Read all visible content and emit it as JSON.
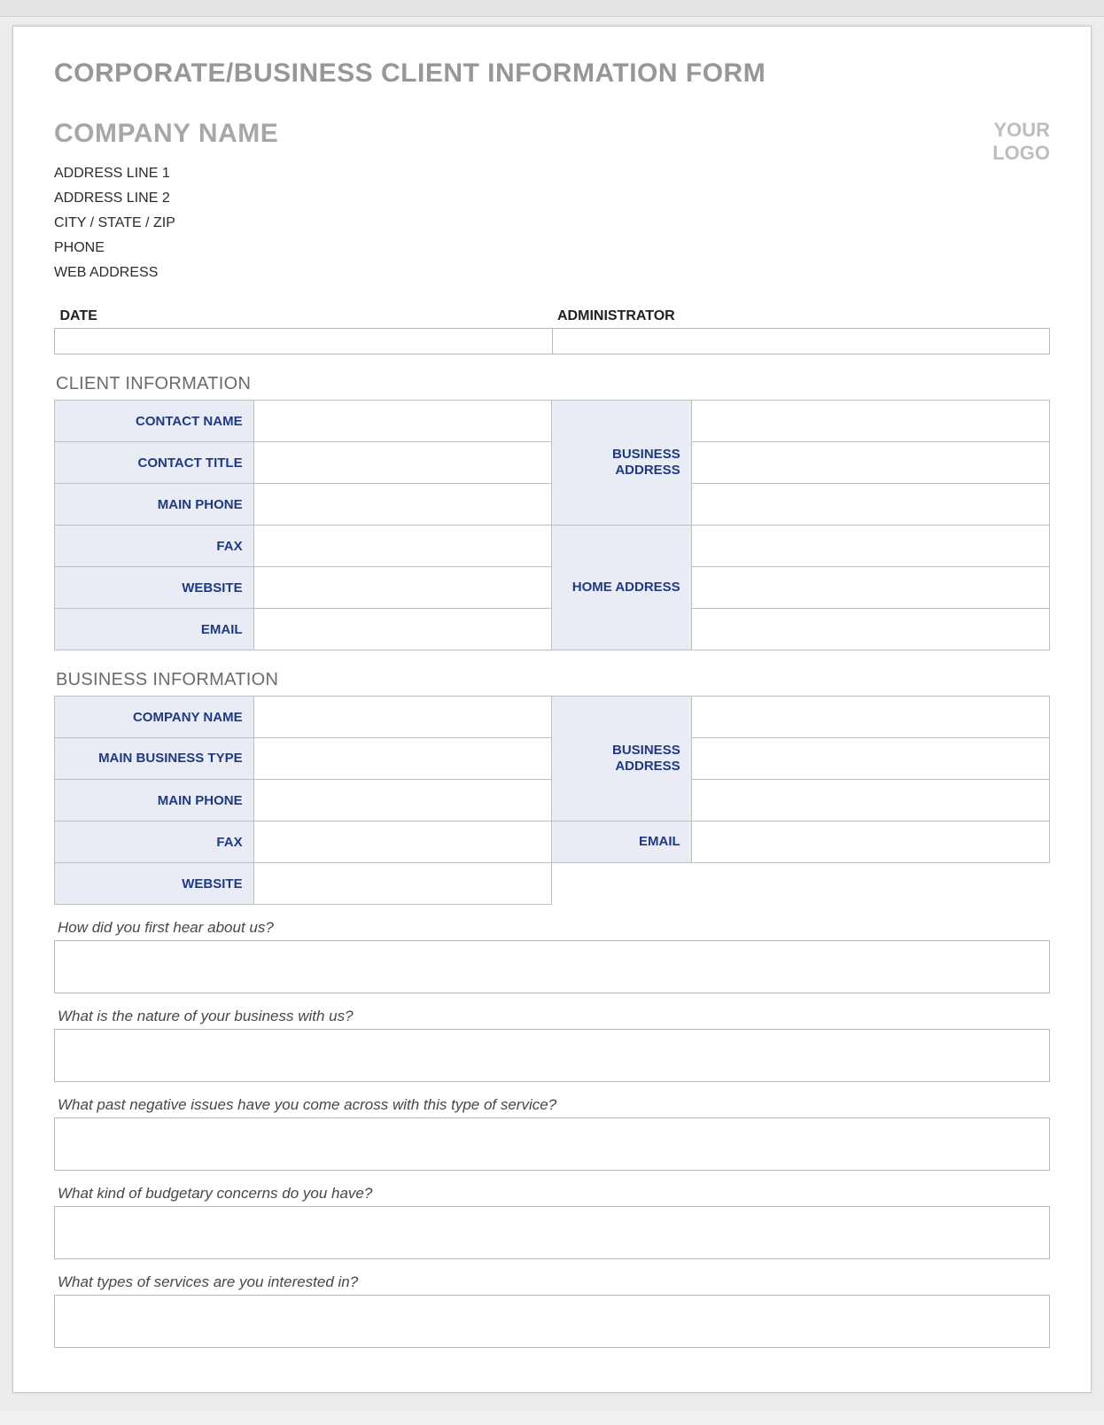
{
  "form_title": "CORPORATE/BUSINESS CLIENT INFORMATION FORM",
  "header": {
    "company_name": "COMPANY NAME",
    "address_lines": [
      "ADDRESS LINE 1",
      "ADDRESS LINE 2",
      "CITY / STATE / ZIP",
      "PHONE",
      "WEB ADDRESS"
    ],
    "logo_line1": "YOUR",
    "logo_line2": "LOGO"
  },
  "date_admin": {
    "date_label": "DATE",
    "admin_label": "ADMINISTRATOR",
    "date_value": "",
    "admin_value": ""
  },
  "client_info": {
    "section": "CLIENT INFORMATION",
    "left_labels": [
      "CONTACT NAME",
      "CONTACT TITLE",
      "MAIN PHONE",
      "FAX",
      "WEBSITE",
      "EMAIL"
    ],
    "business_address_label": "BUSINESS ADDRESS",
    "home_address_label": "HOME ADDRESS"
  },
  "business_info": {
    "section": "BUSINESS INFORMATION",
    "left_labels": [
      "COMPANY NAME",
      "MAIN BUSINESS TYPE",
      "MAIN PHONE",
      "FAX",
      "WEBSITE"
    ],
    "business_address_label": "BUSINESS ADDRESS",
    "email_label": "EMAIL"
  },
  "questions": [
    "How did you first hear about us?",
    "What is the nature of your business with us?",
    "What past negative issues have you come across with this type of service?",
    "What kind of budgetary concerns do you have?",
    "What types of services are you interested in?"
  ]
}
